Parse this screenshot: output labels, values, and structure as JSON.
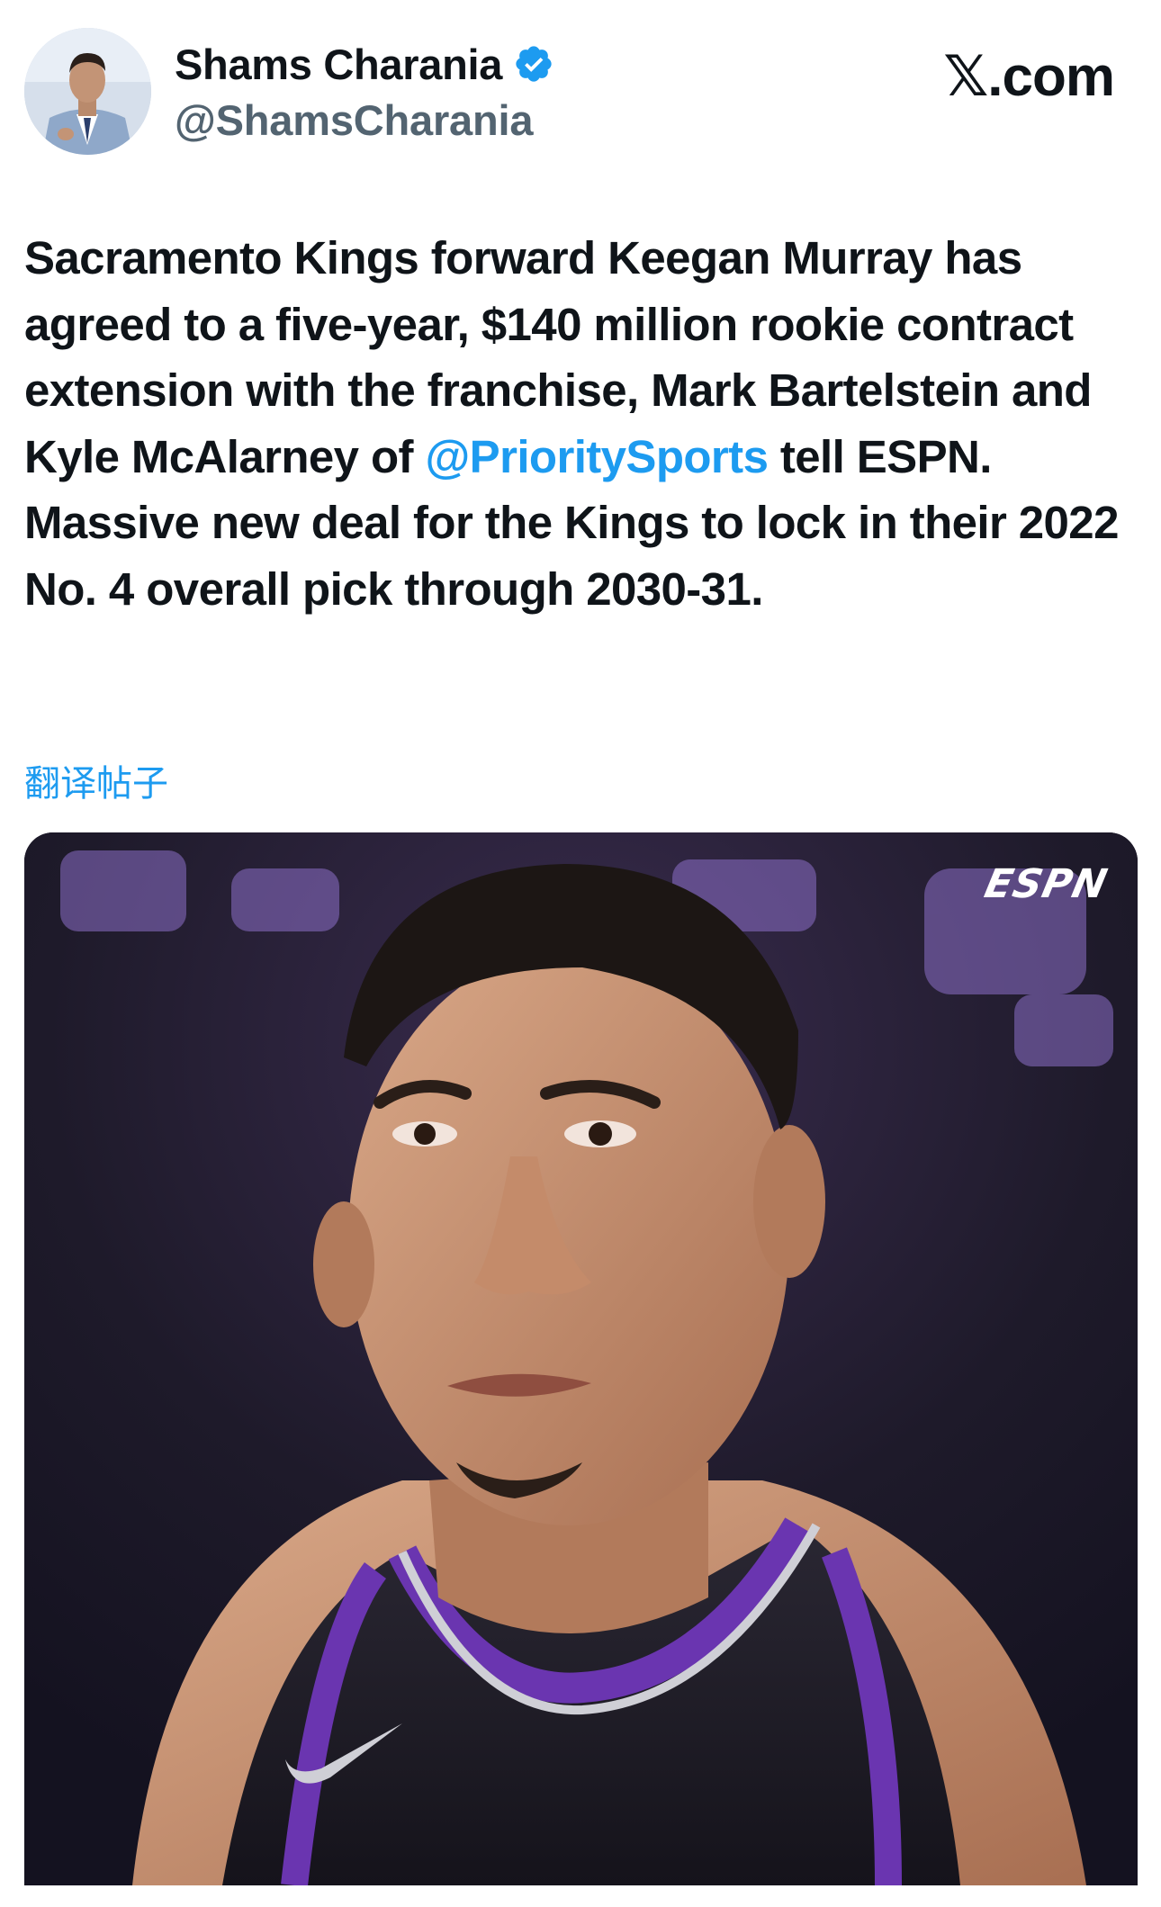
{
  "app": "X",
  "author": {
    "display_name": "Shams Charania",
    "handle": "@ShamsCharania",
    "verified": true,
    "avatar_icon": "avatar-photo"
  },
  "brand": {
    "label_x": "𝕏",
    "label_suffix": ".com"
  },
  "tweet": {
    "text_before_mention": "Sacramento Kings forward Keegan Murray has agreed to a five-year, $140 million rookie contract extension with the franchise, Mark Bartelstein and Kyle McAlarney of",
    "mention": "@PrioritySports",
    "text_after_mention": "tell ESPN. Massive new deal for the Kings to lock in their 2022 No. 4 overall pick through 2030-31."
  },
  "translate_label": "翻译帖子",
  "media": {
    "watermark": "ESPN",
    "description_icon": "player-photo"
  },
  "colors": {
    "accent": "#1d9bf0",
    "text": "#0f1419",
    "secondary_text": "#536471",
    "jersey_purple": "#5a2d91"
  }
}
